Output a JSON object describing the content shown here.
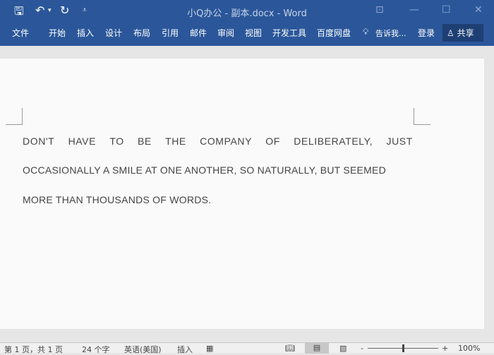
{
  "titlebar": {
    "title": "小Q办公 - 副本.docx - Word",
    "save_icon": "save-icon",
    "undo_icon": "undo-icon",
    "redo_icon": "redo-icon"
  },
  "ribbon": {
    "tabs": [
      "文件",
      "开始",
      "插入",
      "设计",
      "布局",
      "引用",
      "邮件",
      "审阅",
      "视图",
      "开发工具",
      "百度网盘"
    ],
    "tell_me": "告诉我...",
    "login": "登录",
    "share": "共享"
  },
  "document": {
    "lines": [
      [
        "DON'T",
        "HAVE",
        "TO",
        "BE",
        "THE",
        "COMPANY",
        "OF",
        "DELIBERATELY,",
        "JUST"
      ],
      "OCCASIONALLY A SMILE AT ONE ANOTHER, SO NATURALLY, BUT SEEMED",
      "MORE THAN THOUSANDS OF WORDS."
    ]
  },
  "status": {
    "page": "第 1 页，共 1 页",
    "words": "24 个字",
    "language": "英语(美国)",
    "mode": "插入",
    "zoom": "100%",
    "zoom_percent": 100
  },
  "colors": {
    "accent": "#2b579a"
  }
}
